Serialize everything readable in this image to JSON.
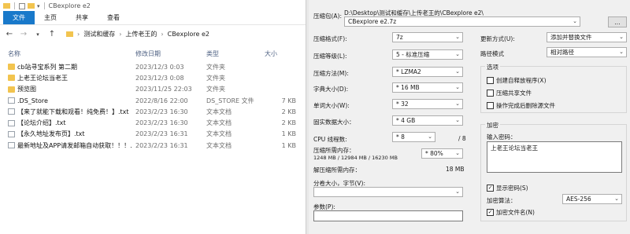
{
  "explorer": {
    "window_title": "CBexplore e2",
    "ribbon_tabs": [
      "文件",
      "主页",
      "共享",
      "查看"
    ],
    "breadcrumb": [
      "测试和缓存",
      "上传老王的",
      "CBexplore e2"
    ],
    "columns": {
      "name": "名称",
      "date": "修改日期",
      "type": "类型",
      "size": "大小"
    },
    "files": [
      {
        "name": "cb站寻宝系列 第二期",
        "date": "2023/12/3 0:03",
        "type": "文件夹",
        "size": "",
        "kind": "folder"
      },
      {
        "name": "上老王论坛当老王",
        "date": "2023/12/3 0:08",
        "type": "文件夹",
        "size": "",
        "kind": "folder"
      },
      {
        "name": "预览图",
        "date": "2023/11/25 22:03",
        "type": "文件夹",
        "size": "",
        "kind": "folder"
      },
      {
        "name": ".DS_Store",
        "date": "2022/8/16 22:00",
        "type": "DS_STORE 文件",
        "size": "7 KB",
        "kind": "file"
      },
      {
        "name": "【来了就能下载和观看！纯免费！】.txt",
        "date": "2023/2/23 16:30",
        "type": "文本文档",
        "size": "2 KB",
        "kind": "file"
      },
      {
        "name": "【论坛介绍】.txt",
        "date": "2023/2/23 16:30",
        "type": "文本文档",
        "size": "2 KB",
        "kind": "file"
      },
      {
        "name": "【永久地址发布页】.txt",
        "date": "2023/2/23 16:31",
        "type": "文本文档",
        "size": "1 KB",
        "kind": "file"
      },
      {
        "name": "最新地址及APP请发邮箱自动获取！！！...",
        "date": "2023/2/23 16:31",
        "type": "文本文档",
        "size": "1 KB",
        "kind": "file"
      }
    ]
  },
  "dialog": {
    "archive_label": "压缩包(A):",
    "archive_path": "D:\\Desktop\\测试和缓存\\上传老王的\\CBexplore e2\\",
    "archive_name": "CBexplore e2.7z",
    "browse_label": "...",
    "format_label": "压缩格式(F):",
    "format_value": "7z",
    "level_label": "压缩等级(L):",
    "level_value": "5 - 标准压缩",
    "method_label": "压缩方法(M):",
    "method_value": "* LZMA2",
    "dict_label": "字典大小(D):",
    "dict_value": "* 16 MB",
    "word_label": "单词大小(W):",
    "word_value": "* 32",
    "solid_label": "固实数据大小：",
    "solid_value": "* 4 GB",
    "threads_label": "CPU 线程数:",
    "threads_value": "* 8",
    "threads_max": "/ 8",
    "mem_label": "压缩所需内存：",
    "mem_detail": "1248 MB / 12984 MB / 16230 MB",
    "mem_percent": "* 80%",
    "decomp_label": "解压缩所需内存：",
    "decomp_value": "18 MB",
    "split_label": "分卷大小，字节(V):",
    "params_label": "参数(P):",
    "update_label": "更新方式(U):",
    "update_value": "添加并替换文件",
    "pathmode_label": "路径模式",
    "pathmode_value": "相对路径",
    "options_title": "选项",
    "opt_sfx": "创建自释放程序(X)",
    "opt_shared": "压缩共享文件",
    "opt_delete": "操作完成后删除源文件",
    "encrypt_title": "加密",
    "pwd_label": "输入密码：",
    "pwd_value": "上老王论坛当老王",
    "show_pwd": "显示密码(S)",
    "enc_method_label": "加密算法：",
    "enc_method_value": "AES-256",
    "enc_names": "加密文件名(N)"
  }
}
